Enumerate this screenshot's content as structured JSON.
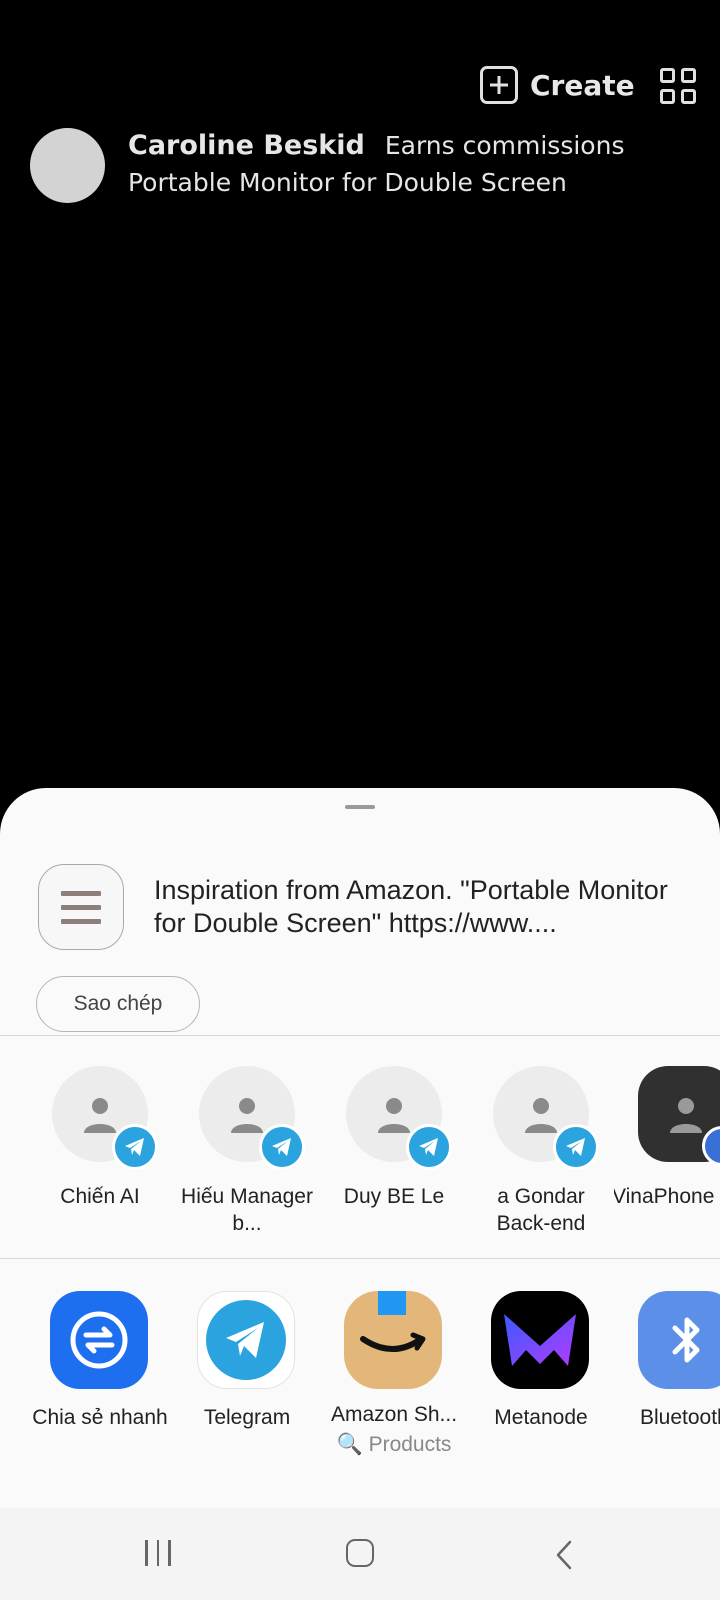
{
  "header": {
    "create_label": "Create"
  },
  "post": {
    "author": "Caroline Beskid",
    "tag": "Earns commissions",
    "title": "Portable Monitor for Double Screen"
  },
  "share_sheet": {
    "preview_text": "Inspiration from Amazon. \"Portable Monitor for Double Screen\" https://www....",
    "copy_label": "Sao chép",
    "contacts": [
      {
        "name": "Chiến AI",
        "app": "Telegram"
      },
      {
        "name": "Hiếu Manager b...",
        "app": "Telegram"
      },
      {
        "name": "Duy BE Le",
        "app": "Telegram"
      },
      {
        "name": "a Gondar Back-end",
        "app": "Telegram"
      },
      {
        "name": "VinaPhone",
        "app": "Messages"
      }
    ],
    "apps": [
      {
        "name": "Chia sẻ nhanh",
        "icon": "quick-share-icon",
        "color": "#1e6ff0"
      },
      {
        "name": "Telegram",
        "icon": "telegram-icon",
        "color": "#2aa3df"
      },
      {
        "name": "Amazon Sh...",
        "sub": "Products",
        "icon": "amazon-shopping-icon",
        "color": "#e3b77a"
      },
      {
        "name": "Metanode",
        "icon": "metanode-icon",
        "color": "#000000"
      },
      {
        "name": "Bluetooth",
        "icon": "bluetooth-icon",
        "color": "#5b8fe8"
      }
    ]
  },
  "navbar": {
    "recent_icon": "recent-apps-icon",
    "home_icon": "home-icon",
    "back_icon": "back-icon"
  }
}
